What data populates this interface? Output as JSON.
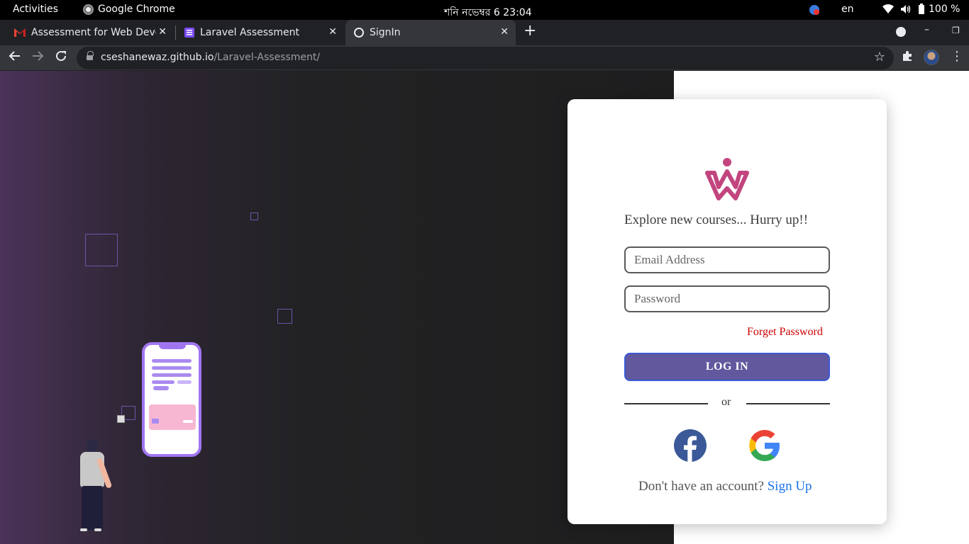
{
  "system_bar": {
    "activities": "Activities",
    "app_name": "Google Chrome",
    "clock": "শনি নভেম্বর 6  23:04",
    "language": "en",
    "battery": "100 %"
  },
  "browser": {
    "tabs": [
      {
        "title": "Assessment for Web Deve",
        "favicon": "gmail-icon",
        "active": false
      },
      {
        "title": "Laravel Assessment",
        "favicon": "sheet-icon",
        "active": false
      },
      {
        "title": "SignIn",
        "favicon": "globe-icon",
        "active": true
      }
    ],
    "tab_close": "✕",
    "new_tab": "+",
    "address": {
      "host": "cseshanewaz.github.io",
      "path": "/Laravel-Assessment/"
    }
  },
  "login": {
    "tagline": "Explore new courses... Hurry up!!",
    "email_placeholder": "Email Address",
    "password_placeholder": "Password",
    "forget_password": "Forget Password",
    "login_button": "LOG IN",
    "or_text": "or",
    "no_account_text": "Don't have an account?",
    "signup_link": "Sign Up"
  },
  "colors": {
    "brand_logo": "#c2457e",
    "login_button": "#61589e",
    "forget_link": "#cc0000",
    "signup_link": "#1a73e8",
    "facebook": "#3b5998"
  }
}
